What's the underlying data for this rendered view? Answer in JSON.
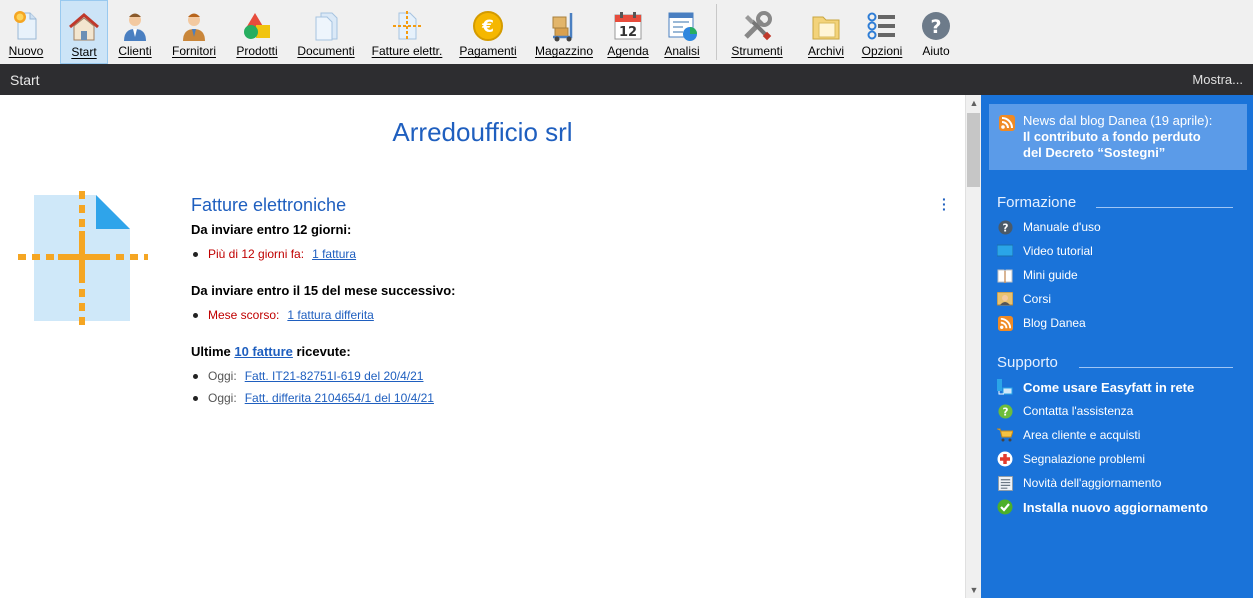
{
  "toolbar": {
    "items": [
      {
        "label": "Nuovo",
        "icon": "new-document-icon"
      },
      {
        "label": "Start",
        "icon": "home-icon"
      },
      {
        "label": "Clienti",
        "icon": "client-person-icon"
      },
      {
        "label": "Fornitori",
        "icon": "supplier-person-icon"
      },
      {
        "label": "Prodotti",
        "icon": "products-shapes-icon"
      },
      {
        "label": "Documenti",
        "icon": "documents-icon"
      },
      {
        "label": "Fatture elettr.",
        "icon": "e-invoice-icon"
      },
      {
        "label": "Pagamenti",
        "icon": "euro-coin-icon"
      },
      {
        "label": "Magazzino",
        "icon": "warehouse-trolley-icon"
      },
      {
        "label": "Agenda",
        "icon": "calendar-icon"
      },
      {
        "label": "Analisi",
        "icon": "analysis-chart-icon"
      },
      {
        "label": "Strumenti",
        "icon": "tools-icon"
      },
      {
        "label": "Archivi",
        "icon": "archive-folder-icon"
      },
      {
        "label": "Opzioni",
        "icon": "options-list-icon"
      },
      {
        "label": "Aiuto",
        "icon": "help-icon"
      }
    ],
    "calendar_day": "12"
  },
  "titlebar": {
    "title": "Start",
    "mostra": "Mostra..."
  },
  "main": {
    "company": "Arredoufficio srl",
    "section_title": "Fatture elettroniche",
    "group1": {
      "heading": "Da inviare entro 12 giorni:",
      "label": "Più di 12 giorni fa:",
      "link": "1 fattura"
    },
    "group2": {
      "heading": "Da inviare entro il 15 del mese successivo:",
      "label": "Mese scorso:",
      "link": "1 fattura differita"
    },
    "group3": {
      "heading_pre": "Ultime ",
      "heading_link": "10 fatture",
      "heading_post": " ricevute:",
      "rows": [
        {
          "label": "Oggi:",
          "link": "Fatt. IT21-82751I-619 del 20/4/21"
        },
        {
          "label": "Oggi:",
          "link": "Fatt. differita 2104654/1 del 10/4/21"
        }
      ]
    }
  },
  "panel": {
    "news_line1": "News dal blog Danea (19 aprile):",
    "news_line2": "Il contributo a fondo perduto",
    "news_line3": "del Decreto “Sostegni”",
    "formazione": {
      "heading": "Formazione",
      "items": [
        {
          "label": "Manuale d'uso",
          "icon": "help-circle-icon"
        },
        {
          "label": "Video tutorial",
          "icon": "video-monitor-icon"
        },
        {
          "label": "Mini guide",
          "icon": "book-icon"
        },
        {
          "label": "Corsi",
          "icon": "teacher-icon"
        },
        {
          "label": "Blog Danea",
          "icon": "rss-icon"
        }
      ]
    },
    "supporto": {
      "heading": "Supporto",
      "items": [
        {
          "label": "Come usare Easyfatt in rete",
          "icon": "network-icon",
          "bold": true
        },
        {
          "label": "Contatta l'assistenza",
          "icon": "support-question-icon"
        },
        {
          "label": "Area cliente e acquisti",
          "icon": "cart-icon"
        },
        {
          "label": "Segnalazione problemi",
          "icon": "red-cross-icon"
        },
        {
          "label": "Novità dell'aggiornamento",
          "icon": "news-list-icon"
        },
        {
          "label": "Installa nuovo aggiornamento",
          "icon": "green-check-icon",
          "bold": true
        }
      ]
    }
  },
  "colors": {
    "accent": "#1f5fbf",
    "panel": "#1a73d9",
    "titlebar": "#2d2d30",
    "alert": "#c00000"
  }
}
